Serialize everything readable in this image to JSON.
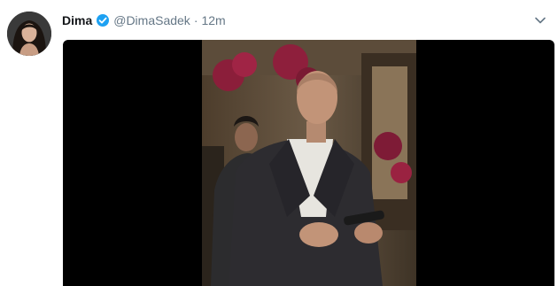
{
  "tweet": {
    "author_name": "Dima",
    "handle": "@DimaSadek",
    "separator": "·",
    "timestamp": "12m",
    "verified": true
  },
  "icons": {
    "verified": "verified-badge-icon",
    "caret": "chevron-down-icon"
  },
  "colors": {
    "name": "#14171a",
    "secondary": "#657786",
    "verified": "#1da1f2",
    "media_background": "#000000"
  }
}
